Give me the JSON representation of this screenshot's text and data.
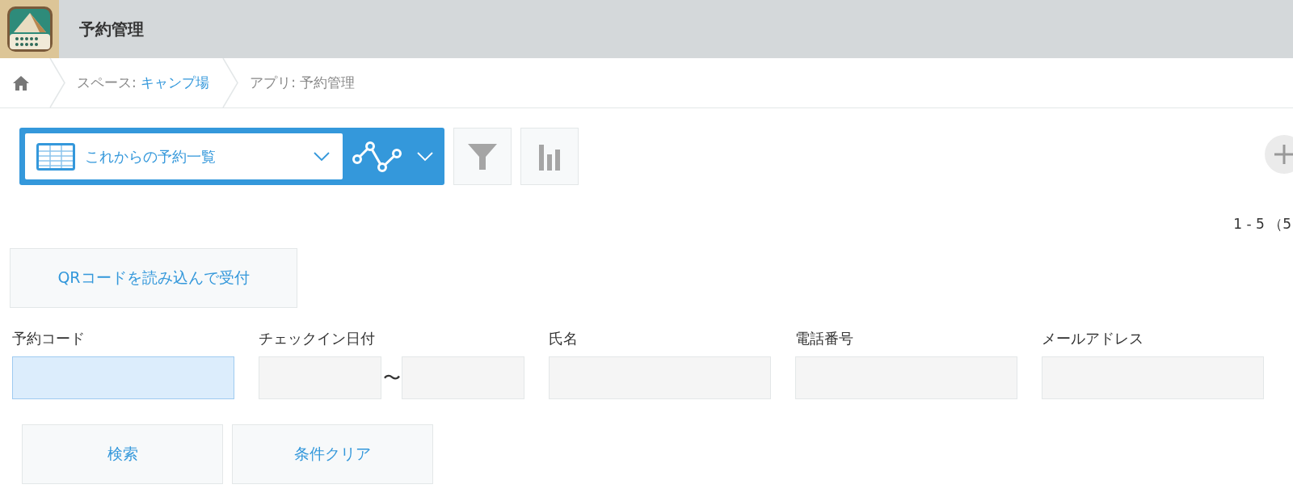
{
  "header": {
    "title": "予約管理"
  },
  "breadcrumb": [
    {
      "kind": "home"
    },
    {
      "kind": "link",
      "prefix": "スペース: ",
      "label": "キャンプ場"
    },
    {
      "kind": "text",
      "prefix": "アプリ: ",
      "label": "予約管理"
    }
  ],
  "toolbar": {
    "view": "これからの予約一覧"
  },
  "pagination": "1 - 5 （5",
  "qr_button": "QRコードを読み込んで受付",
  "search_fields": [
    {
      "kind": "single",
      "label": "予約コード",
      "focused": true
    },
    {
      "kind": "range",
      "label": "チェックイン日付",
      "separator": "〜"
    },
    {
      "kind": "single",
      "label": "氏名",
      "focused": false
    },
    {
      "kind": "single",
      "label": "電話番号",
      "focused": false
    },
    {
      "kind": "single",
      "label": "メールアドレス",
      "focused": false
    }
  ],
  "buttons": [
    "検索",
    "条件クリア"
  ]
}
